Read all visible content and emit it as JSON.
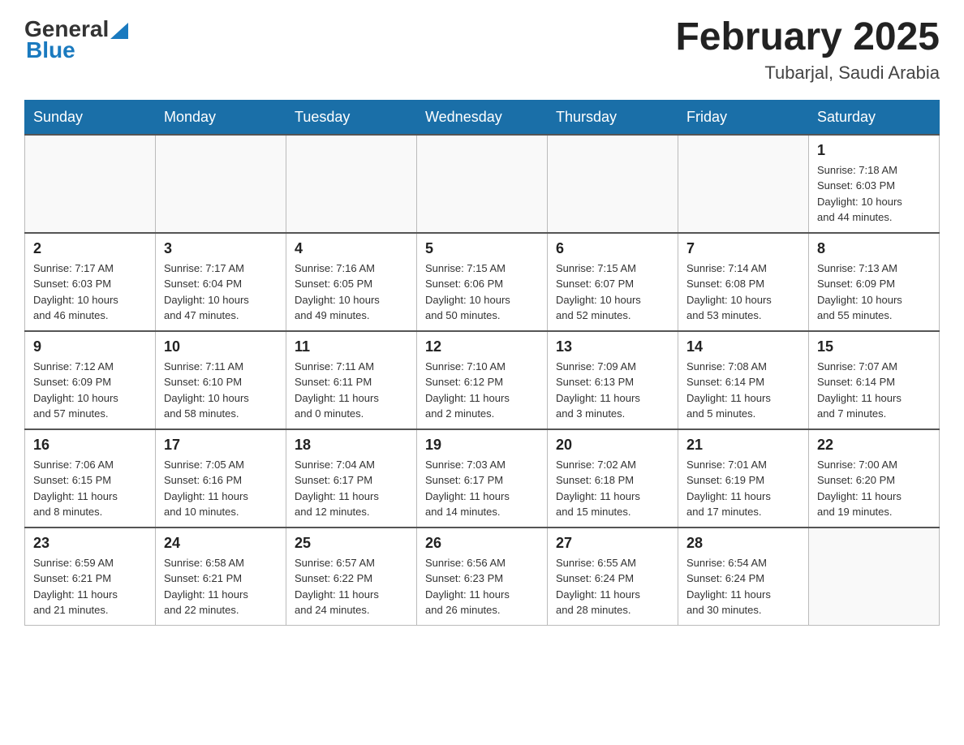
{
  "header": {
    "logo_general": "General",
    "logo_blue": "Blue",
    "title": "February 2025",
    "subtitle": "Tubarjal, Saudi Arabia"
  },
  "days_of_week": [
    "Sunday",
    "Monday",
    "Tuesday",
    "Wednesday",
    "Thursday",
    "Friday",
    "Saturday"
  ],
  "weeks": [
    {
      "days": [
        {
          "number": "",
          "info": ""
        },
        {
          "number": "",
          "info": ""
        },
        {
          "number": "",
          "info": ""
        },
        {
          "number": "",
          "info": ""
        },
        {
          "number": "",
          "info": ""
        },
        {
          "number": "",
          "info": ""
        },
        {
          "number": "1",
          "info": "Sunrise: 7:18 AM\nSunset: 6:03 PM\nDaylight: 10 hours\nand 44 minutes."
        }
      ]
    },
    {
      "days": [
        {
          "number": "2",
          "info": "Sunrise: 7:17 AM\nSunset: 6:03 PM\nDaylight: 10 hours\nand 46 minutes."
        },
        {
          "number": "3",
          "info": "Sunrise: 7:17 AM\nSunset: 6:04 PM\nDaylight: 10 hours\nand 47 minutes."
        },
        {
          "number": "4",
          "info": "Sunrise: 7:16 AM\nSunset: 6:05 PM\nDaylight: 10 hours\nand 49 minutes."
        },
        {
          "number": "5",
          "info": "Sunrise: 7:15 AM\nSunset: 6:06 PM\nDaylight: 10 hours\nand 50 minutes."
        },
        {
          "number": "6",
          "info": "Sunrise: 7:15 AM\nSunset: 6:07 PM\nDaylight: 10 hours\nand 52 minutes."
        },
        {
          "number": "7",
          "info": "Sunrise: 7:14 AM\nSunset: 6:08 PM\nDaylight: 10 hours\nand 53 minutes."
        },
        {
          "number": "8",
          "info": "Sunrise: 7:13 AM\nSunset: 6:09 PM\nDaylight: 10 hours\nand 55 minutes."
        }
      ]
    },
    {
      "days": [
        {
          "number": "9",
          "info": "Sunrise: 7:12 AM\nSunset: 6:09 PM\nDaylight: 10 hours\nand 57 minutes."
        },
        {
          "number": "10",
          "info": "Sunrise: 7:11 AM\nSunset: 6:10 PM\nDaylight: 10 hours\nand 58 minutes."
        },
        {
          "number": "11",
          "info": "Sunrise: 7:11 AM\nSunset: 6:11 PM\nDaylight: 11 hours\nand 0 minutes."
        },
        {
          "number": "12",
          "info": "Sunrise: 7:10 AM\nSunset: 6:12 PM\nDaylight: 11 hours\nand 2 minutes."
        },
        {
          "number": "13",
          "info": "Sunrise: 7:09 AM\nSunset: 6:13 PM\nDaylight: 11 hours\nand 3 minutes."
        },
        {
          "number": "14",
          "info": "Sunrise: 7:08 AM\nSunset: 6:14 PM\nDaylight: 11 hours\nand 5 minutes."
        },
        {
          "number": "15",
          "info": "Sunrise: 7:07 AM\nSunset: 6:14 PM\nDaylight: 11 hours\nand 7 minutes."
        }
      ]
    },
    {
      "days": [
        {
          "number": "16",
          "info": "Sunrise: 7:06 AM\nSunset: 6:15 PM\nDaylight: 11 hours\nand 8 minutes."
        },
        {
          "number": "17",
          "info": "Sunrise: 7:05 AM\nSunset: 6:16 PM\nDaylight: 11 hours\nand 10 minutes."
        },
        {
          "number": "18",
          "info": "Sunrise: 7:04 AM\nSunset: 6:17 PM\nDaylight: 11 hours\nand 12 minutes."
        },
        {
          "number": "19",
          "info": "Sunrise: 7:03 AM\nSunset: 6:17 PM\nDaylight: 11 hours\nand 14 minutes."
        },
        {
          "number": "20",
          "info": "Sunrise: 7:02 AM\nSunset: 6:18 PM\nDaylight: 11 hours\nand 15 minutes."
        },
        {
          "number": "21",
          "info": "Sunrise: 7:01 AM\nSunset: 6:19 PM\nDaylight: 11 hours\nand 17 minutes."
        },
        {
          "number": "22",
          "info": "Sunrise: 7:00 AM\nSunset: 6:20 PM\nDaylight: 11 hours\nand 19 minutes."
        }
      ]
    },
    {
      "days": [
        {
          "number": "23",
          "info": "Sunrise: 6:59 AM\nSunset: 6:21 PM\nDaylight: 11 hours\nand 21 minutes."
        },
        {
          "number": "24",
          "info": "Sunrise: 6:58 AM\nSunset: 6:21 PM\nDaylight: 11 hours\nand 22 minutes."
        },
        {
          "number": "25",
          "info": "Sunrise: 6:57 AM\nSunset: 6:22 PM\nDaylight: 11 hours\nand 24 minutes."
        },
        {
          "number": "26",
          "info": "Sunrise: 6:56 AM\nSunset: 6:23 PM\nDaylight: 11 hours\nand 26 minutes."
        },
        {
          "number": "27",
          "info": "Sunrise: 6:55 AM\nSunset: 6:24 PM\nDaylight: 11 hours\nand 28 minutes."
        },
        {
          "number": "28",
          "info": "Sunrise: 6:54 AM\nSunset: 6:24 PM\nDaylight: 11 hours\nand 30 minutes."
        },
        {
          "number": "",
          "info": ""
        }
      ]
    }
  ]
}
